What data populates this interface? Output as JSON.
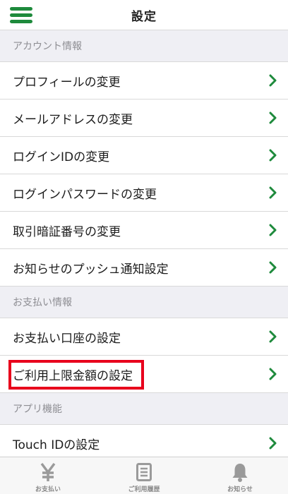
{
  "header": {
    "title": "設定",
    "menu_icon": "hamburger-menu-icon"
  },
  "colors": {
    "accent_green": "#1e8a3c",
    "highlight_red": "#e8001c",
    "section_bg": "#efeff4",
    "icon_gray": "#9a9a9a"
  },
  "sections": [
    {
      "title": "アカウント情報",
      "items": [
        {
          "label": "プロフィールの変更"
        },
        {
          "label": "メールアドレスの変更"
        },
        {
          "label": "ログインIDの変更"
        },
        {
          "label": "ログインパスワードの変更"
        },
        {
          "label": "取引暗証番号の変更"
        },
        {
          "label": "お知らせのプッシュ通知設定"
        }
      ]
    },
    {
      "title": "お支払い情報",
      "items": [
        {
          "label": "お支払い口座の設定"
        },
        {
          "label": "ご利用上限金額の設定"
        }
      ]
    },
    {
      "title": "アプリ機能",
      "items": [
        {
          "label": "Touch IDの設定"
        }
      ]
    }
  ],
  "tabbar": {
    "tabs": [
      {
        "label": "お支払い",
        "icon": "yen-icon"
      },
      {
        "label": "ご利用履歴",
        "icon": "document-icon"
      },
      {
        "label": "お知らせ",
        "icon": "bell-icon"
      }
    ]
  }
}
